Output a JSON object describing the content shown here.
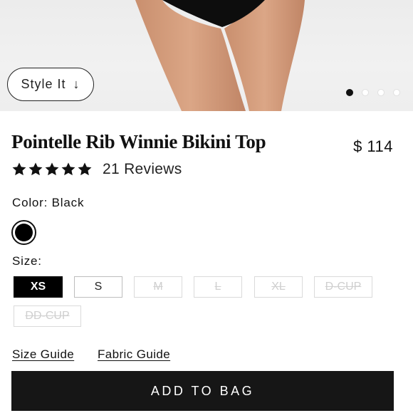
{
  "gallery": {
    "style_it_label": "Style It",
    "style_it_icon": "arrow-down-icon",
    "dot_count": 4,
    "active_index": 0
  },
  "product": {
    "title": "Pointelle Rib Winnie Bikini Top",
    "price": "$ 114",
    "rating_stars": 5,
    "reviews_label": "21 Reviews"
  },
  "color": {
    "label": "Color: Black",
    "swatches": [
      {
        "name": "Black",
        "hex": "#000000",
        "selected": true
      }
    ]
  },
  "size": {
    "label": "Size:",
    "options": [
      {
        "label": "XS",
        "state": "selected"
      },
      {
        "label": "S",
        "state": "available"
      },
      {
        "label": "M",
        "state": "unavailable"
      },
      {
        "label": "L",
        "state": "unavailable"
      },
      {
        "label": "XL",
        "state": "unavailable"
      },
      {
        "label": "D-CUP",
        "state": "unavailable"
      },
      {
        "label": "DD-CUP",
        "state": "unavailable"
      }
    ]
  },
  "links": {
    "size_guide": "Size Guide",
    "fabric_guide": "Fabric Guide"
  },
  "cta": {
    "add_to_bag": "ADD TO BAG"
  },
  "colors": {
    "button_bg": "#161616",
    "selected_size_bg": "#000000",
    "disabled_text": "#cfcfcf"
  }
}
